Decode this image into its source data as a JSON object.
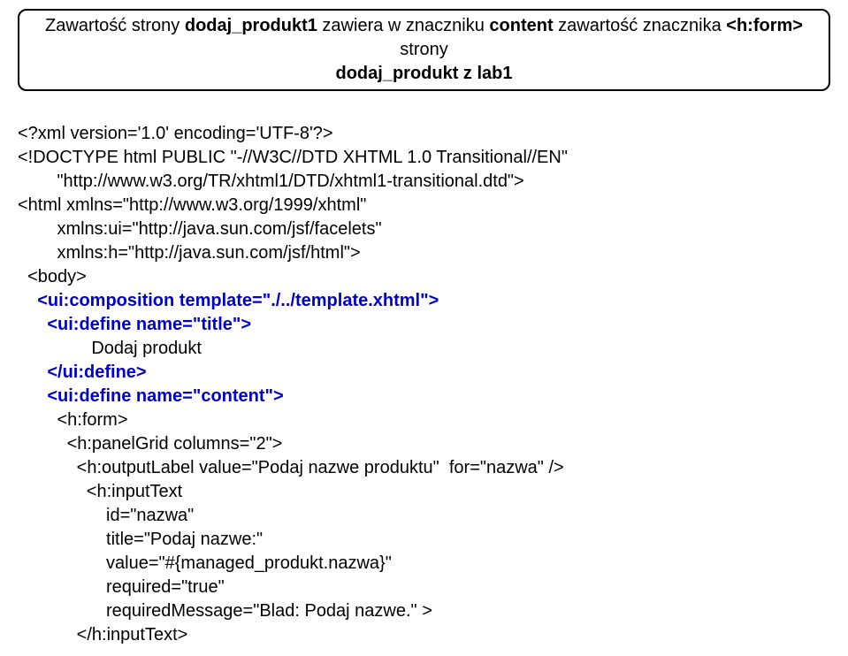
{
  "header": {
    "line1_a": "Zawartość strony ",
    "line1_b": "dodaj_produkt1",
    "line1_c": " zawiera w znaczniku ",
    "line1_d": "content",
    "line1_e": " zawartość znacznika ",
    "line1_f": "<h:form>",
    "line1_g": " strony",
    "line2_a": "dodaj_produkt z lab1"
  },
  "code": {
    "l1": "<?xml version='1.0' encoding='UTF-8'?>",
    "l2": "<!DOCTYPE html PUBLIC \"-//W3C//DTD XHTML 1.0 Transitional//EN\"",
    "l3": "        \"http://www.w3.org/TR/xhtml1/DTD/xhtml1-transitional.dtd\">",
    "l4": "<html xmlns=\"http://www.w3.org/1999/xhtml\"",
    "l5": "        xmlns:ui=\"http://java.sun.com/jsf/facelets\"",
    "l6": "        xmlns:h=\"http://java.sun.com/jsf/html\">",
    "l7": "  <body>",
    "l8": "    <ui:composition template=\"./../template.xhtml\">",
    "l9": "      <ui:define name=\"title\">",
    "l10": "               Dodaj produkt",
    "l11": "      </ui:define>",
    "l12": "      <ui:define name=\"content\">",
    "l13": "        <h:form>",
    "l14": "          <h:panelGrid columns=\"2\">",
    "l15": "            <h:outputLabel value=\"Podaj nazwe produktu\"  for=\"nazwa\" />",
    "l16": "              <h:inputText",
    "l17": "                  id=\"nazwa\"",
    "l18": "                  title=\"Podaj nazwe:\"",
    "l19": "                  value=\"#{managed_produkt.nazwa}\"",
    "l20": "                  required=\"true\"",
    "l21": "                  requiredMessage=\"Blad: Podaj nazwe.\" >",
    "l22": "            </h:inputText>"
  }
}
